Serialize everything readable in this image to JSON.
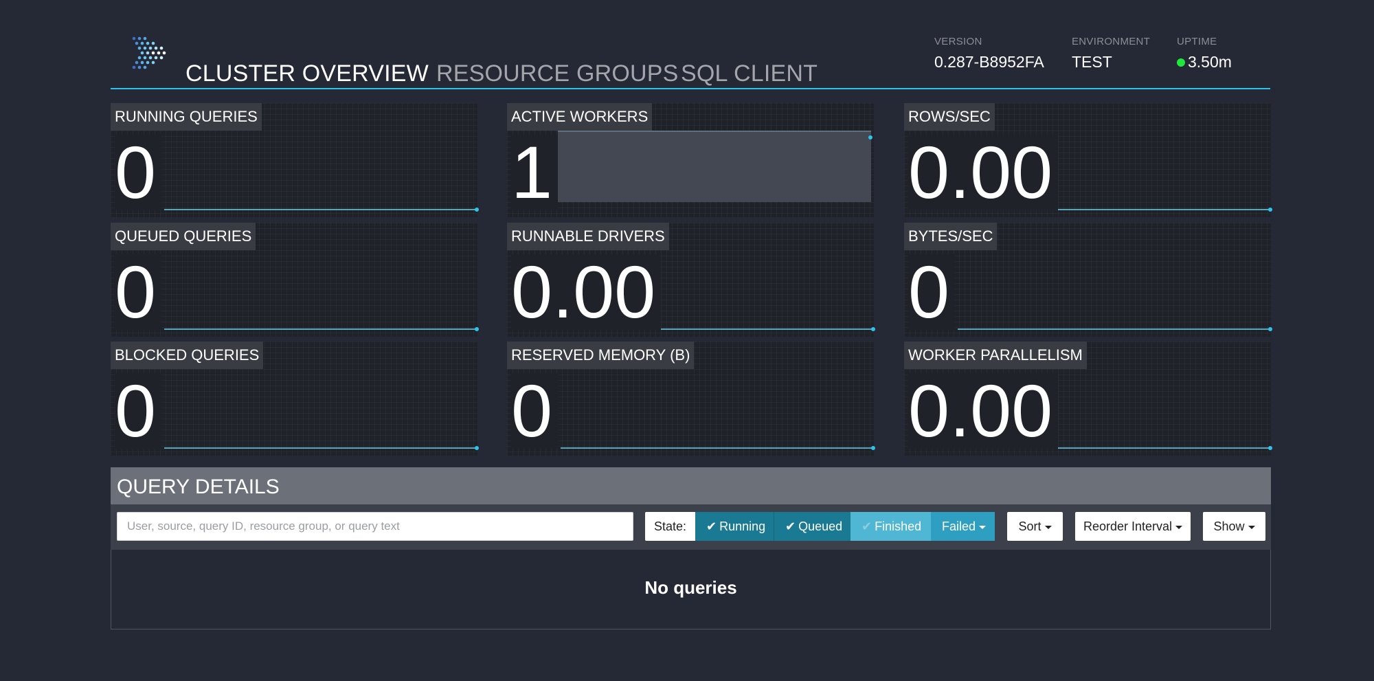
{
  "header": {
    "nav": {
      "cluster_overview": "CLUSTER OVERVIEW",
      "resource_groups": "RESOURCE GROUPS",
      "sql_client": "SQL CLIENT"
    },
    "version": {
      "label": "VERSION",
      "value": "0.287-B8952FA"
    },
    "environment": {
      "label": "ENVIRONMENT",
      "value": "TEST"
    },
    "uptime": {
      "label": "UPTIME",
      "value": "3.50m",
      "status_color": "#1ee83c"
    },
    "accent_color": "#2ec3ea"
  },
  "stats": {
    "running_queries": {
      "label": "RUNNING QUERIES",
      "value": "0"
    },
    "active_workers": {
      "label": "ACTIVE WORKERS",
      "value": "1"
    },
    "rows_sec": {
      "label": "ROWS/SEC",
      "value": "0.00"
    },
    "queued_queries": {
      "label": "QUEUED QUERIES",
      "value": "0"
    },
    "runnable_drivers": {
      "label": "RUNNABLE DRIVERS",
      "value": "0.00"
    },
    "bytes_sec": {
      "label": "BYTES/SEC",
      "value": "0"
    },
    "blocked_queries": {
      "label": "BLOCKED QUERIES",
      "value": "0"
    },
    "reserved_memory": {
      "label": "RESERVED MEMORY (B)",
      "value": "0"
    },
    "worker_parallelism": {
      "label": "WORKER PARALLELISM",
      "value": "0.00"
    }
  },
  "query_details": {
    "title": "QUERY DETAILS",
    "search_placeholder": "User, source, query ID, resource group, or query text",
    "state_label": "State:",
    "states": {
      "running": "Running",
      "queued": "Queued",
      "finished": "Finished",
      "failed": "Failed"
    },
    "sort_label": "Sort",
    "reorder_label": "Reorder Interval",
    "show_label": "Show",
    "empty_message": "No queries"
  },
  "icons": {
    "logo": "presto-logo-icon",
    "check": "check-icon",
    "caret": "chevron-down-icon"
  }
}
